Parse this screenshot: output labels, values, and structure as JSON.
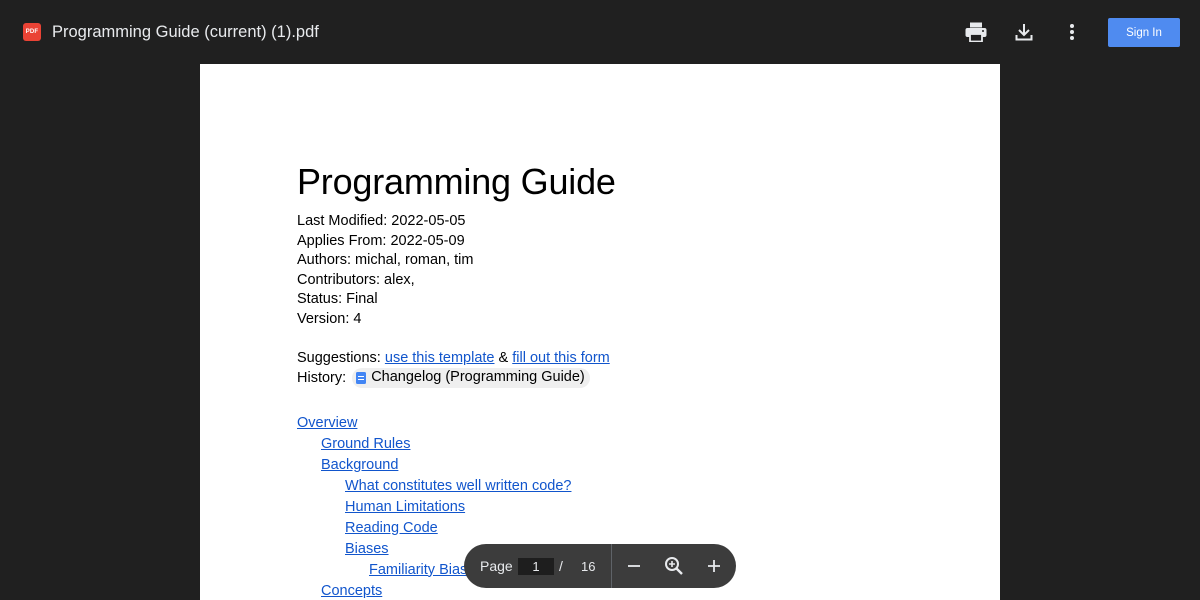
{
  "toolbar": {
    "file_icon_label": "PDF",
    "title": "Programming Guide (current) (1).pdf",
    "print_icon": "print-icon",
    "download_icon": "download-icon",
    "more_icon": "more-vert-icon",
    "signin_label": "Sign In",
    "signin_color": "#4f8bf0"
  },
  "document": {
    "heading": "Programming Guide",
    "meta": [
      "Last Modified: 2022-05-05",
      "Applies From: 2022-05-09",
      "Authors: michal, roman, tim",
      "Contributors: alex,",
      "Status: Final",
      "Version: 4"
    ],
    "suggestions": {
      "label": "Suggestions:",
      "link1": "use this template",
      "joiner": "&",
      "link2": "fill out this form"
    },
    "history": {
      "label": "History:",
      "chip_icon": "google-doc-icon",
      "chip_text": "Changelog (Programming Guide)"
    },
    "toc": [
      {
        "label": "Overview",
        "level": 1
      },
      {
        "label": "Ground Rules",
        "level": 2
      },
      {
        "label": "Background",
        "level": 2
      },
      {
        "label": "What constitutes well written code?",
        "level": 3
      },
      {
        "label": "Human Limitations",
        "level": 3
      },
      {
        "label": "Reading Code",
        "level": 3
      },
      {
        "label": "Biases",
        "level": 3
      },
      {
        "label": "Familiarity Bias",
        "level": 4
      },
      {
        "label": "Concepts",
        "level": 2
      }
    ],
    "link_color": "#1155cc"
  },
  "pager": {
    "page_label": "Page",
    "current_page": "1",
    "separator": "/",
    "total_pages": "16",
    "zoom_out_icon": "minus-icon",
    "fit_icon": "zoom-search-icon",
    "zoom_in_icon": "plus-icon"
  }
}
